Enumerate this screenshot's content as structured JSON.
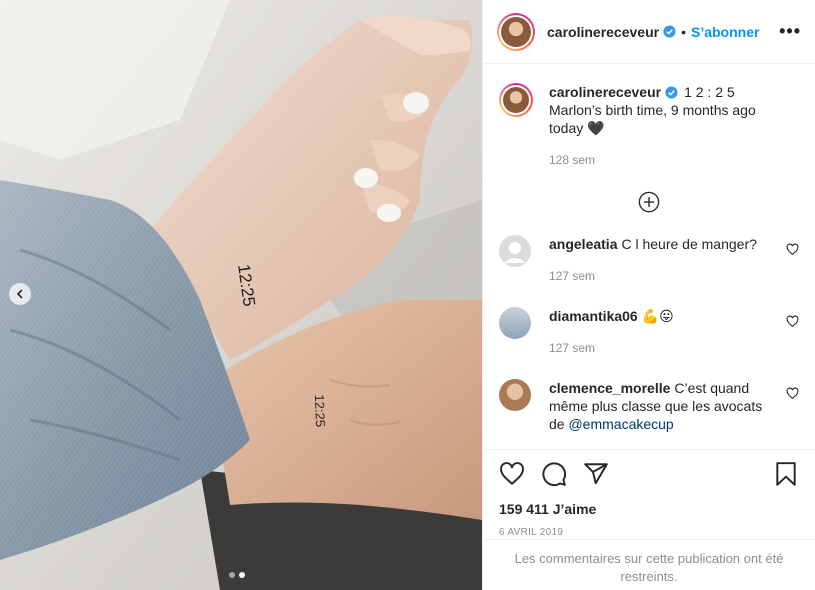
{
  "post": {
    "author": {
      "username": "carolinereceveur",
      "verified": true,
      "follow_label": "S’abonner",
      "separator": "•"
    },
    "more_label": "•••",
    "caption": {
      "username": "carolinereceveur",
      "line1": "1 2 : 2 5",
      "line2": "Marlon’s birth time, 9 months ago today 🖤",
      "age": "128 sem"
    },
    "comments": [
      {
        "username": "angeleatia",
        "text": "C l heure de manger?",
        "age": "127 sem"
      },
      {
        "username": "diamantika06",
        "text": "💪😛",
        "age": "127 sem"
      },
      {
        "username": "clemence_morelle",
        "text": "C’est quand même plus classe que les avocats de ",
        "mention": "@emmacakecup"
      }
    ],
    "likes": "159 411 J’aime",
    "date": "6 AVRIL 2019",
    "restricted_notice": "Les commentaires sur cette publication ont été restreints.",
    "image": {
      "tattoo_1": "12:25",
      "tattoo_2": "12:25",
      "carousel_total": 2,
      "carousel_active": 2
    },
    "colors": {
      "accent": "#0095f6",
      "secondary_text": "#8e8e8e",
      "border": "#efefef"
    }
  }
}
